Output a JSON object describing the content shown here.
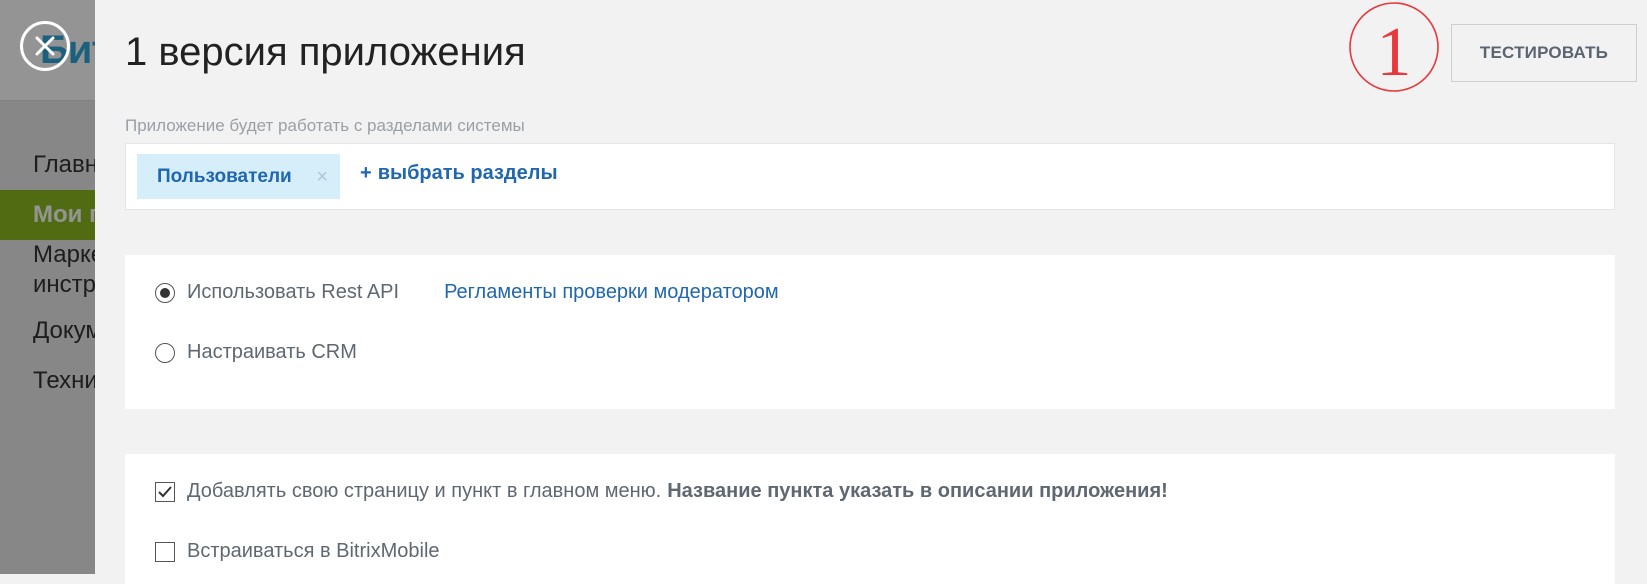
{
  "background_page": {
    "logo_text": "Бит",
    "menu": [
      {
        "label": "Главн",
        "active": false
      },
      {
        "label": "Мои п",
        "active": true
      },
      {
        "label": "Марке\nинстр",
        "active": false
      },
      {
        "label": "Докум",
        "active": false
      },
      {
        "label": "Техни",
        "active": false
      }
    ]
  },
  "slider": {
    "title": "1 версия приложения",
    "test_button": "ТЕСТИРОВАТЬ",
    "annotation_number": "1",
    "sections": {
      "label": "Приложение будет работать с разделами системы",
      "tags": [
        {
          "label": "Пользователи",
          "remove_icon": "×"
        }
      ],
      "add_link": "выбрать разделы",
      "add_plus": "+"
    },
    "api_options": {
      "rest_api": {
        "label": "Использовать Rest API",
        "checked": true
      },
      "moderator_link": "Регламенты проверки модератором",
      "crm": {
        "label": "Настраивать CRM",
        "checked": false
      }
    },
    "menu_options": {
      "add_page": {
        "label": "Добавлять свою страницу и пункт в главном меню.",
        "note": "Название пункта указать в описании приложения!",
        "checked": true
      },
      "bitrix_mobile": {
        "label": "Встраиваться в BitrixMobile",
        "checked": false
      }
    }
  },
  "colors": {
    "accent_blue": "#2067b0",
    "tag_bg": "#d6eef9",
    "annotation_red": "#e8383b",
    "active_menu_green": "#8cb821"
  }
}
